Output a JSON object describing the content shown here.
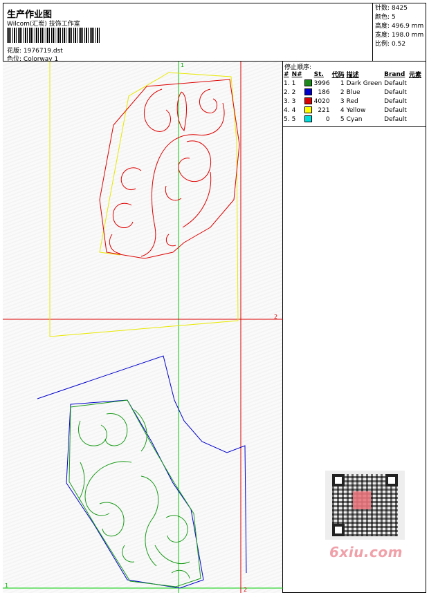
{
  "header": {
    "title": "生产作业图",
    "subtitle": "Wilcom(汇炭) 技饰工作室",
    "design_label": "花版:",
    "design_value": "1976719.dst",
    "colorway_label": "色位:",
    "colorway_value": "Colorway 1"
  },
  "stats": [
    {
      "label": "针数:",
      "value": "8425"
    },
    {
      "label": "颜色:",
      "value": "5"
    },
    {
      "label": "高度:",
      "value": "496.9 mm"
    },
    {
      "label": "宽度:",
      "value": "198.0 mm"
    },
    {
      "label": "比例:",
      "value": "0.52"
    }
  ],
  "stop_sequence": {
    "title": "停止顺序:",
    "columns": [
      "#",
      "N#",
      "St.",
      "代码",
      "描述",
      "Brand",
      "元素"
    ],
    "rows": [
      {
        "idx": "1.",
        "n": "1",
        "stitches": "3996",
        "code": "1",
        "desc": "Dark Green",
        "brand": "Default",
        "color": "#1a8a1a"
      },
      {
        "idx": "2.",
        "n": "2",
        "stitches": "186",
        "code": "2",
        "desc": "Blue",
        "brand": "Default",
        "color": "#0000cc"
      },
      {
        "idx": "3.",
        "n": "3",
        "stitches": "4020",
        "code": "3",
        "desc": "Red",
        "brand": "Default",
        "color": "#dd0000"
      },
      {
        "idx": "4.",
        "n": "4",
        "stitches": "221",
        "code": "4",
        "desc": "Yellow",
        "brand": "Default",
        "color": "#ffff00"
      },
      {
        "idx": "5.",
        "n": "5",
        "stitches": "0",
        "code": "5",
        "desc": "Cyan",
        "brand": "Default",
        "color": "#00dddd"
      }
    ]
  },
  "guides": {
    "v1_label": "1",
    "h2_label": "2",
    "h1_label": "1",
    "v2_label": "2",
    "guide_green": "#00cc00",
    "guide_red": "#dd0000"
  },
  "watermark": {
    "text": "6xiu.com"
  }
}
